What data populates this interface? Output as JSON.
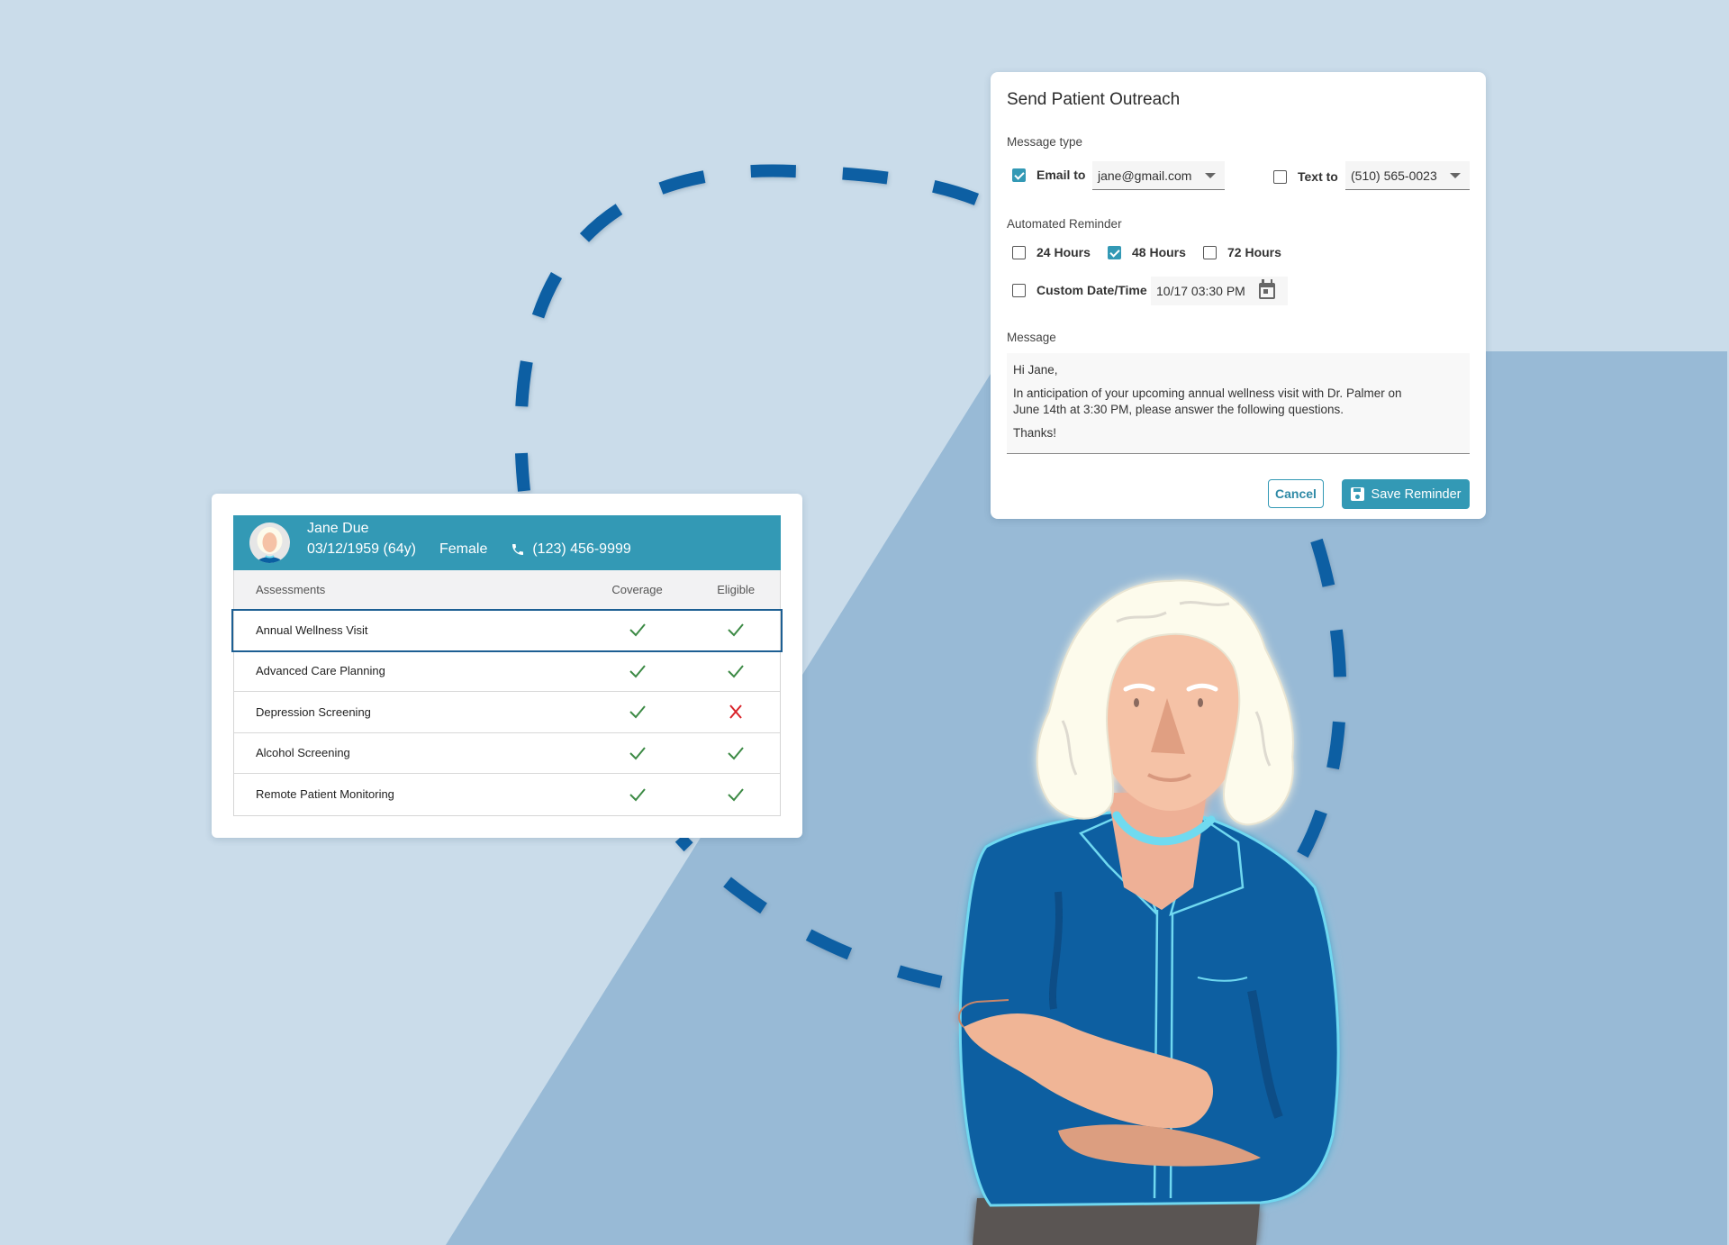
{
  "colors": {
    "background_light": "#cadcea",
    "background_dark": "#98bad6",
    "dash": "#0a5ea3",
    "accent": "#3399b5",
    "selected_row_border": "#1d5f93",
    "check_green": "#3c8a45",
    "cross_red": "#d9232a",
    "shirt_blue": "#0a5fa1",
    "shirt_outline": "#6fd8f0"
  },
  "outreach_dialog": {
    "title": "Send Patient Outreach",
    "message_type": {
      "label": "Message type",
      "email": {
        "label": "Email to",
        "checked": true,
        "value": "jane@gmail.com"
      },
      "text": {
        "label": "Text to",
        "checked": false,
        "value": "(510) 565-0023"
      }
    },
    "automated_reminder": {
      "label": "Automated Reminder",
      "options": [
        {
          "label": "24 Hours",
          "checked": false
        },
        {
          "label": "48 Hours",
          "checked": true
        },
        {
          "label": "72 Hours",
          "checked": false
        }
      ],
      "custom": {
        "label": "Custom Date/Time",
        "checked": false,
        "value": "10/17 03:30 PM",
        "icon": "calendar-icon"
      }
    },
    "message": {
      "label": "Message",
      "greeting": "Hi Jane,",
      "body_line1": "In anticipation of your upcoming annual wellness visit with Dr. Palmer on",
      "body_line2": "June 14th at 3:30 PM, please answer the following questions.",
      "closing": "Thanks!"
    },
    "buttons": {
      "cancel": "Cancel",
      "save": "Save Reminder",
      "save_icon": "floppy-disk-icon"
    }
  },
  "patient_card": {
    "name": "Jane Due",
    "dob": "03/12/1959 (64y)",
    "sex": "Female",
    "phone": "(123) 456-9999",
    "phone_icon": "phone-icon",
    "columns": [
      "Assessments",
      "Coverage",
      "Eligible"
    ],
    "rows": [
      {
        "assessment": "Annual Wellness Visit",
        "coverage": true,
        "eligible": true,
        "selected": true
      },
      {
        "assessment": "Advanced Care Planning",
        "coverage": true,
        "eligible": true,
        "selected": false
      },
      {
        "assessment": "Depression Screening",
        "coverage": true,
        "eligible": false,
        "selected": false
      },
      {
        "assessment": "Alcohol Screening",
        "coverage": true,
        "eligible": true,
        "selected": false
      },
      {
        "assessment": "Remote Patient Monitoring",
        "coverage": true,
        "eligible": true,
        "selected": false
      }
    ]
  }
}
